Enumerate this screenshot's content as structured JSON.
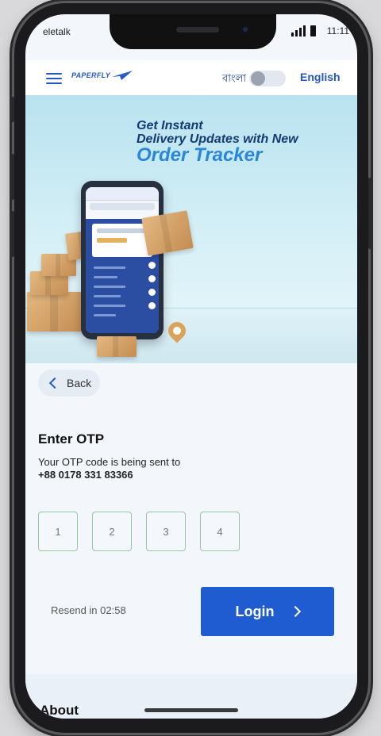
{
  "status_bar": {
    "carrier": "eletalk",
    "time": "11:11"
  },
  "header": {
    "logo_text": "PAPERFLY",
    "lang_bn": "বাংলা",
    "lang_en": "English",
    "toggle_state": "off"
  },
  "banner": {
    "line1": "Get Instant",
    "line2": "Delivery Updates with New",
    "line3": "Order Tracker"
  },
  "back_label": "Back",
  "otp": {
    "title": "Enter OTP",
    "subtitle": "Your OTP code is being sent to",
    "phone": "+88 0178 331 83366",
    "placeholders": [
      "1",
      "2",
      "3",
      "4"
    ]
  },
  "resend_text": "Resend in 02:58",
  "login_label": "Login",
  "footer": {
    "about": "About"
  },
  "colors": {
    "accent": "#1f5bd1",
    "otp_border": "#95c89d",
    "brand": "#2458c7"
  }
}
